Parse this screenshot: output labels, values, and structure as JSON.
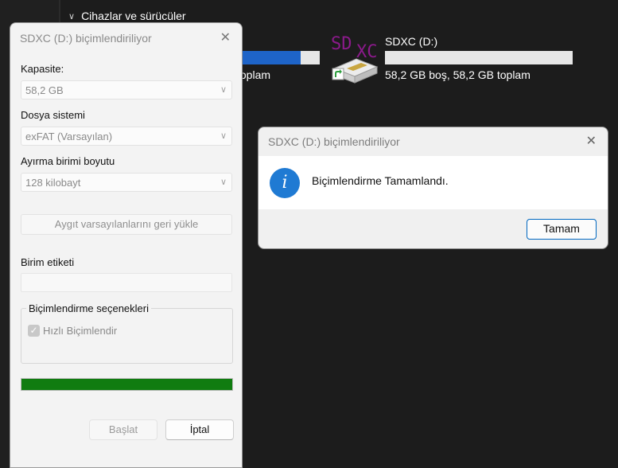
{
  "background": {
    "section_header": "Cihazlar ve sürücüler",
    "drive1": {
      "space_text": "toplam",
      "used_fraction": 0.78
    },
    "drive2": {
      "icon_text_sd": "SD",
      "icon_text_xc": "XC",
      "name": "SDXC (D:)",
      "space_text": "58,2 GB boş, 58,2 GB toplam",
      "used_fraction": 0.0
    }
  },
  "format_dialog": {
    "title": "SDXC (D:) biçimlendiriliyor",
    "capacity_label": "Kapasite:",
    "capacity_value": "58,2 GB",
    "filesystem_label": "Dosya sistemi",
    "filesystem_value": "exFAT (Varsayılan)",
    "allocation_label": "Ayırma birimi boyutu",
    "allocation_value": "128 kilobayt",
    "restore_defaults_button": "Aygıt varsayılanlarını geri yükle",
    "volume_label_label": "Birim etiketi",
    "volume_label_value": "",
    "format_options_title": "Biçimlendirme seçenekleri",
    "quick_format_label": "Hızlı Biçimlendir",
    "quick_format_checked": true,
    "progress_fraction": 1.0,
    "start_button": "Başlat",
    "cancel_button": "İptal",
    "accent_color": "#107c10"
  },
  "message_box": {
    "title": "SDXC (D:) biçimlendiriliyor",
    "message": "Biçimlendirme Tamamlandı.",
    "ok_button": "Tamam",
    "icon": "info-icon",
    "accent_color": "#0067c0"
  }
}
